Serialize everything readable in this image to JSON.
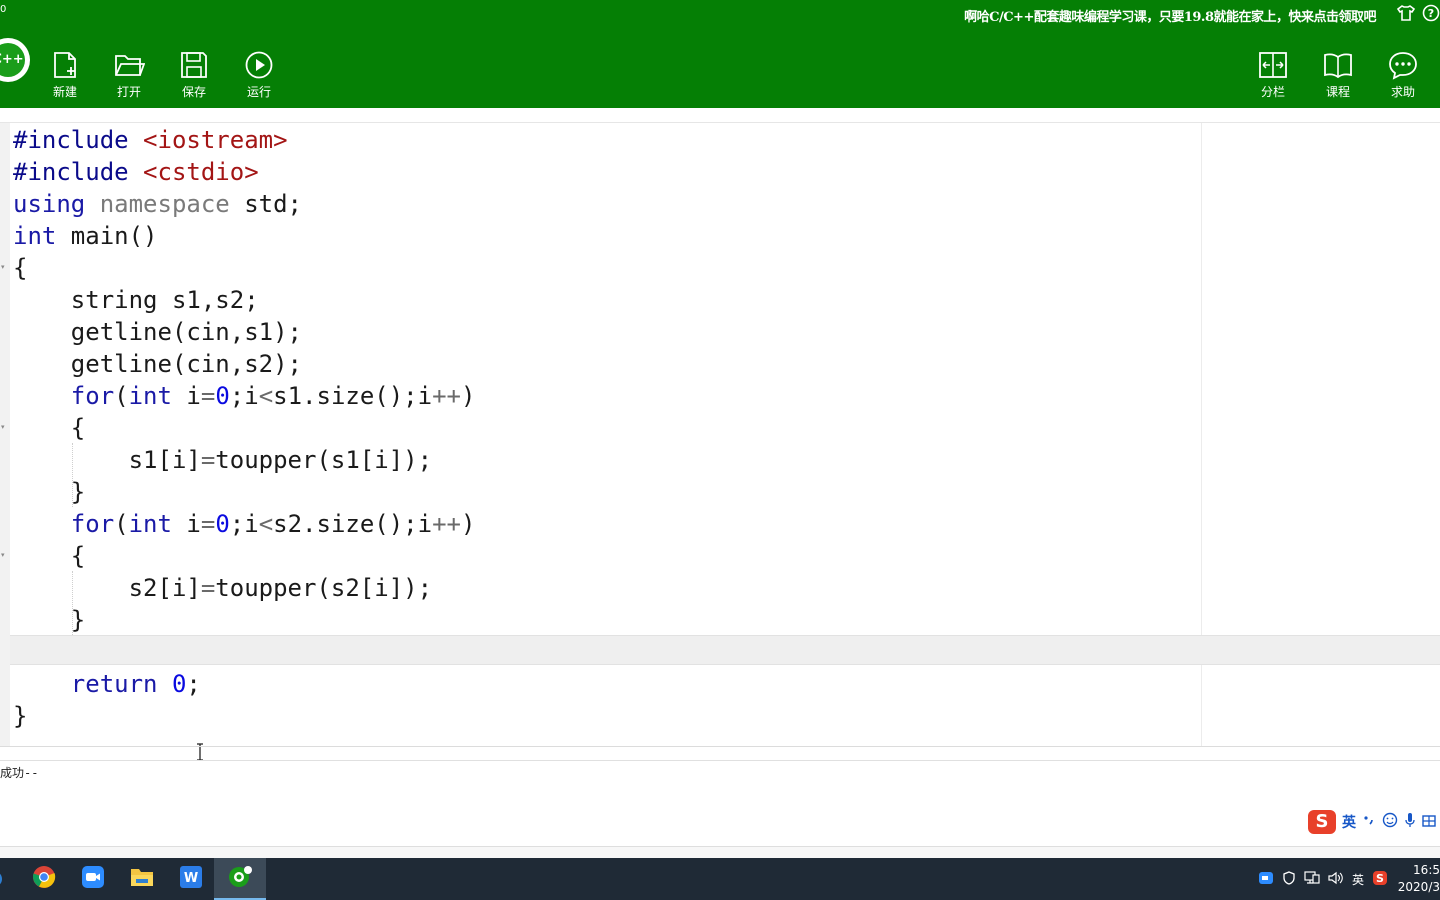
{
  "window": {
    "corner_text": "0",
    "promo_text": "啊哈C/C++配套趣味编程学习课，只要19.8就能在家上，快来点击领取吧",
    "logo_text": "C++"
  },
  "toolbar": {
    "left_buttons": [
      {
        "label": "新建",
        "icon": "new-file-icon"
      },
      {
        "label": "打开",
        "icon": "open-folder-icon"
      },
      {
        "label": "保存",
        "icon": "save-icon"
      },
      {
        "label": "运行",
        "icon": "run-icon"
      }
    ],
    "right_buttons": [
      {
        "label": "分栏",
        "icon": "split-view-icon"
      },
      {
        "label": "课程",
        "icon": "book-icon"
      },
      {
        "label": "求助",
        "icon": "chat-bubble-icon"
      }
    ]
  },
  "editor": {
    "lines": [
      "#include <iostream>",
      "#include <cstdio>",
      "using namespace std;",
      "int main()",
      "{",
      "    string s1,s2;",
      "    getline(cin,s1);",
      "    getline(cin,s2);",
      "    for(int i=0;i<s1.size();i++)",
      "    {",
      "        s1[i]=toupper(s1[i]);",
      "    }",
      "    for(int i=0;i<s2.size();i++)",
      "    {",
      "        s2[i]=toupper(s2[i]);",
      "    }",
      "",
      "    return 0;",
      "}"
    ],
    "current_line": 17
  },
  "output": {
    "text": "成功--"
  },
  "ime": {
    "logo": "S",
    "mode": "英"
  },
  "taskbar": {
    "apps": [
      "chrome-icon",
      "zoom-icon",
      "file-explorer-icon",
      "wps-writer-icon",
      "aha-cpp-icon"
    ],
    "tray_lang": "英",
    "clock_time": "16:5",
    "clock_date": "2020/3"
  },
  "colors": {
    "toolbar_bg": "#057f05",
    "keyword": "#1a1aa6",
    "header": "#a31515",
    "number": "#0a0ae0"
  }
}
